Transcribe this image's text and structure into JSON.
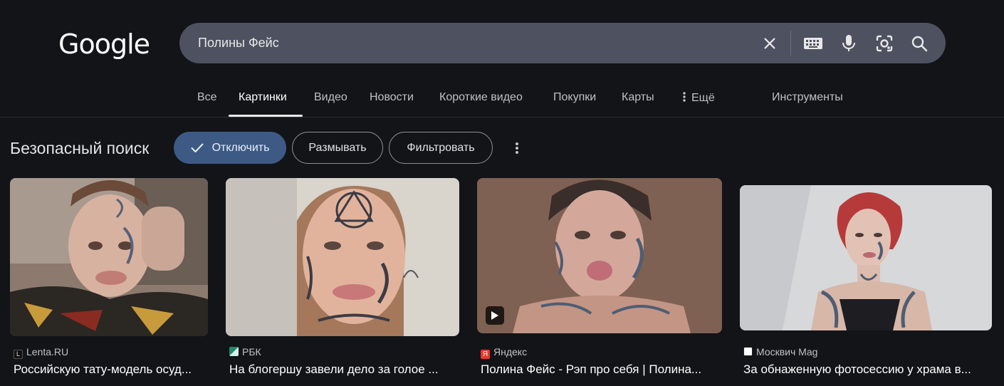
{
  "logo": "Google",
  "search": {
    "query": "Полины Фейс"
  },
  "tabs": [
    {
      "label": "Все"
    },
    {
      "label": "Картинки"
    },
    {
      "label": "Видео"
    },
    {
      "label": "Новости"
    },
    {
      "label": "Короткие видео"
    },
    {
      "label": "Покупки"
    },
    {
      "label": "Карты"
    },
    {
      "label": "Ещё"
    },
    {
      "label": "Инструменты"
    }
  ],
  "safesearch": {
    "label": "Безопасный поиск",
    "options": [
      {
        "label": "Отключить",
        "selected": true
      },
      {
        "label": "Размывать",
        "selected": false
      },
      {
        "label": "Фильтровать",
        "selected": false
      }
    ]
  },
  "results": [
    {
      "source": "Lenta.RU",
      "title": "Российскую тату-модель осуд...",
      "fav_color": "#111111",
      "fav_letter": "L"
    },
    {
      "source": "РБК",
      "title": "На блогершу завели дело за голое ...",
      "fav_color": "#1f8a6e",
      "fav_letter": ""
    },
    {
      "source": "Яндекс",
      "title": "Полина Фейс - Рэп про себя | Полина...",
      "fav_color": "#e8382c",
      "fav_letter": "Я"
    },
    {
      "source": "Москвич Mag",
      "title": "За обнаженную фотосессию у храма в...",
      "fav_color": "#ffffff",
      "fav_letter": ""
    }
  ],
  "colors": {
    "accent_chip": "#3d5a85",
    "background": "#131418",
    "searchbar": "#4d5160"
  }
}
